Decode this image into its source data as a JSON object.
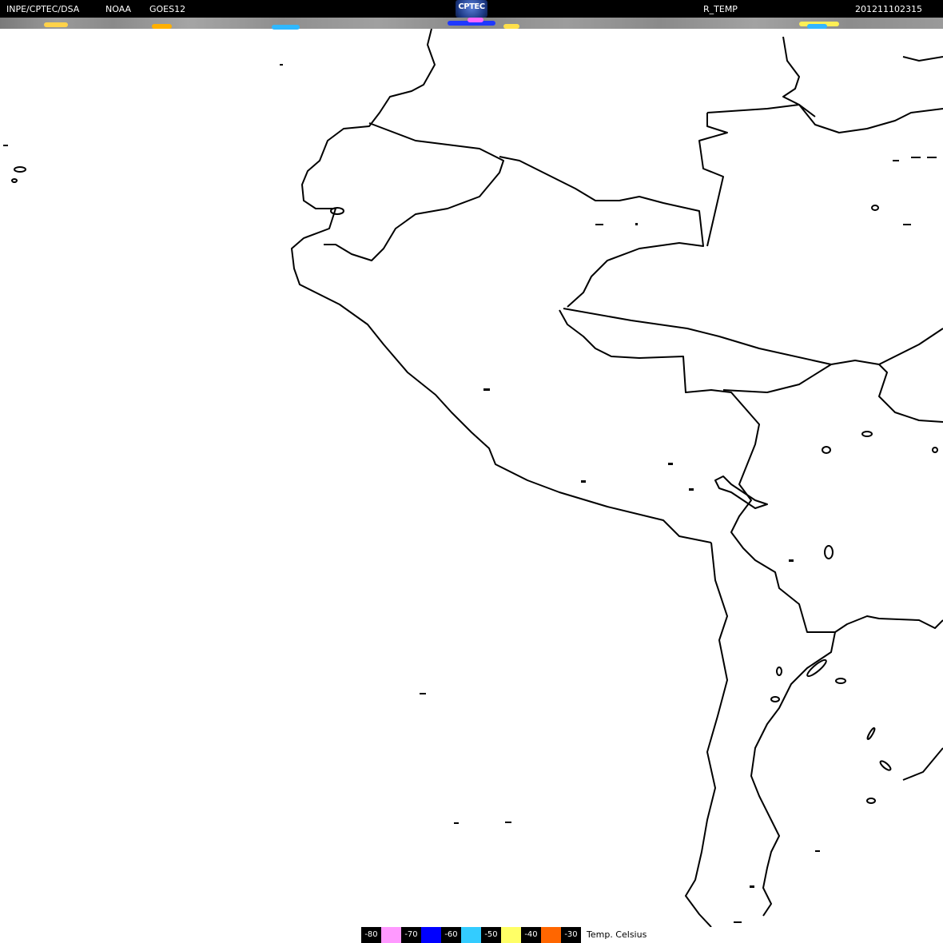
{
  "header": {
    "left1": "INPE/CPTEC/DSA",
    "left2": "NOAA",
    "left3": "GOES12",
    "product": "R_TEMP",
    "timestamp": "201211102315",
    "logo": "CPTEC"
  },
  "legend": {
    "items": [
      {
        "label": "-80",
        "color": "#ff99ff"
      },
      {
        "label": "-70",
        "color": "#0000ff"
      },
      {
        "label": "-60",
        "color": "#33ccff"
      },
      {
        "label": "-50",
        "color": "#ffff66"
      },
      {
        "label": "-40",
        "color": "#ff6600"
      },
      {
        "label": "-30",
        "color": ""
      }
    ],
    "caption": "Temp. Celsius"
  },
  "colors": {
    "background": "#ffffff",
    "coastline": "#000000",
    "bar": "#000000"
  }
}
